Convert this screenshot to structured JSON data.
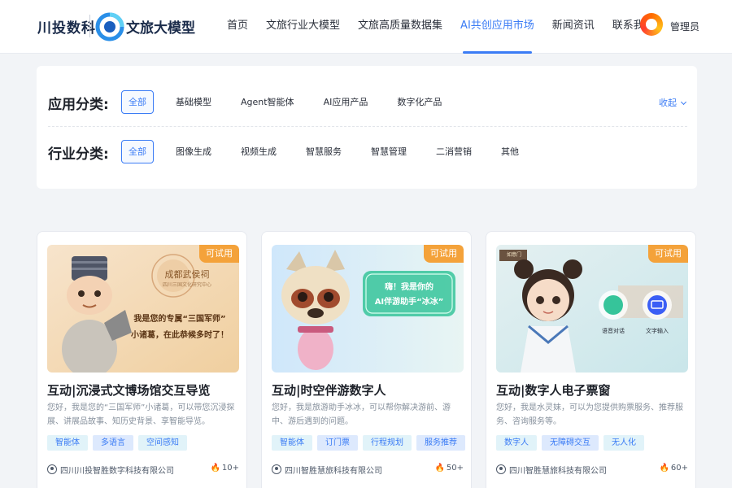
{
  "header": {
    "brand": "川投数科",
    "logo_text": "文旅大模型",
    "nav": [
      "首页",
      "文旅行业大模型",
      "文旅高质量数据集",
      "AI共创应用市场",
      "新闻资讯",
      "联系我们"
    ],
    "active_nav": "AI共创应用市场",
    "user": "管理员"
  },
  "filters": {
    "app_category": {
      "title": "应用分类:",
      "options": [
        "全部",
        "基础模型",
        "Agent智能体",
        "AI应用产品",
        "数字化产品"
      ],
      "selected": "全部"
    },
    "industry_category": {
      "title": "行业分类:",
      "options": [
        "全部",
        "图像生成",
        "视频生成",
        "智慧服务",
        "智慧管理",
        "二消营销",
        "其他"
      ],
      "selected": "全部"
    },
    "collapse_label": "收起"
  },
  "cards": [
    {
      "badge": "可试用",
      "title": "互动|沉浸式文博场馆交互导览",
      "description": "您好，我是您的“三国军师”小诸葛，可以带您沉浸探展、讲展品故事、知历史背景、享智能导览。",
      "tags": [
        "智能体",
        "多语言",
        "空间感知"
      ],
      "organization": "四川川投智胜数字科技有限公司",
      "heat": "10+",
      "cover": {
        "seal_title": "成都武侯祠",
        "seal_sub": "四川三国文化研究中心",
        "bubble_line1": "我是您的专属“三国军师”",
        "bubble_line2": "小诸葛，在此恭候多时了！"
      }
    },
    {
      "badge": "可试用",
      "title": "互动|时空伴游数字人",
      "description": "您好，我是旅游助手冰冰，可以帮你解决游前、游中、游后遇到的问题。",
      "tags": [
        "智能体",
        "订门票",
        "行程规划",
        "服务推荐"
      ],
      "organization": "四川智胜慧旅科技有限公司",
      "heat": "50+",
      "cover": {
        "bubble_line1": "嗨！我是你的",
        "bubble_line2": "AI伴游助手“冰冰”"
      }
    },
    {
      "badge": "可试用",
      "title": "互动|数字人电子票窗",
      "description": "您好，我是水灵妹，可以为您提供购票服务、推荐服务、咨询服务等。",
      "tags": [
        "数字人",
        "无障碍交互",
        "无人化"
      ],
      "organization": "四川智胜慧旅科技有限公司",
      "heat": "60+",
      "cover": {
        "sign": "如意门",
        "btn_voice": "语音对话",
        "btn_text": "文字输入"
      }
    }
  ],
  "colors": {
    "accent": "#3b7cf5",
    "badge": "#f4a23a",
    "tag_bg": "#e1f3f9",
    "flame": "#ff7a1a"
  }
}
